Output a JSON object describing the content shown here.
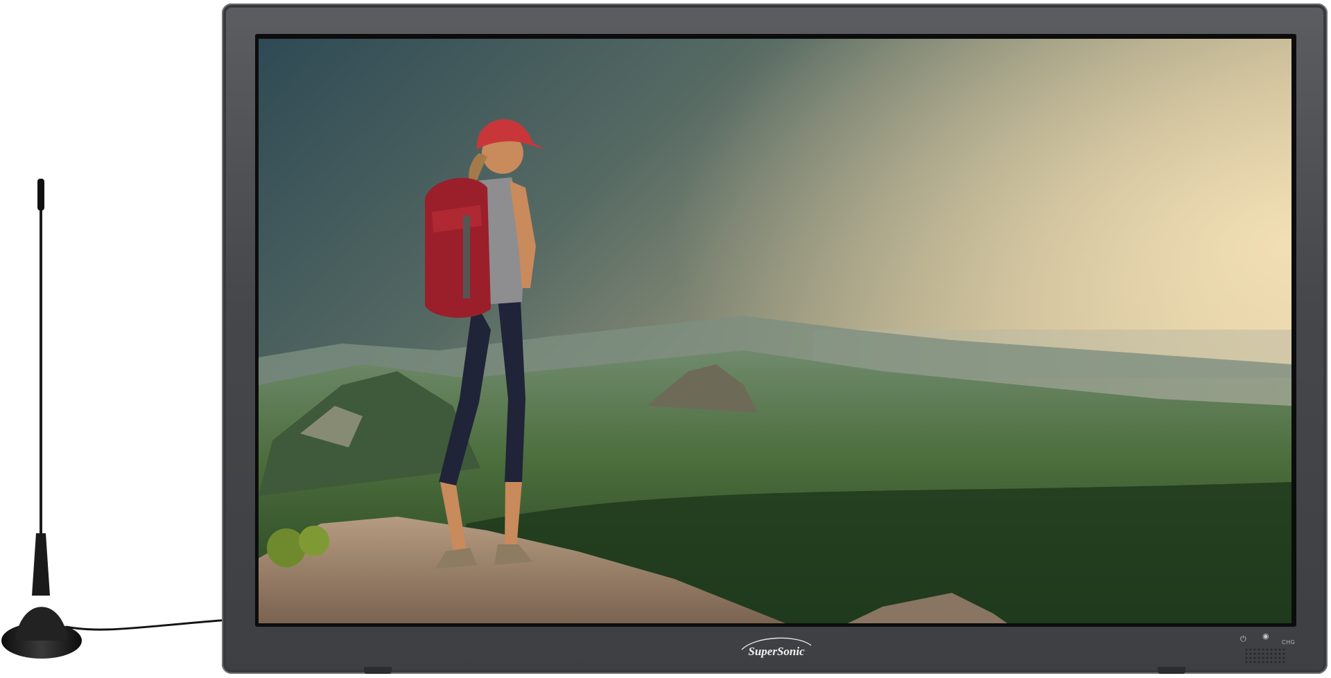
{
  "tv": {
    "brand_logo_text": "SuperSonic",
    "brand_colors": {
      "bezel": "#45474a",
      "screen_frame": "#0c0c0d"
    },
    "controls": {
      "power_icon": "power-icon",
      "sensor_icon": "ir-sensor-icon",
      "charge_label": "CHG"
    }
  },
  "antenna": {
    "icon": "antenna-icon"
  },
  "screen_image": {
    "icon": "landscape-hiker-image"
  }
}
